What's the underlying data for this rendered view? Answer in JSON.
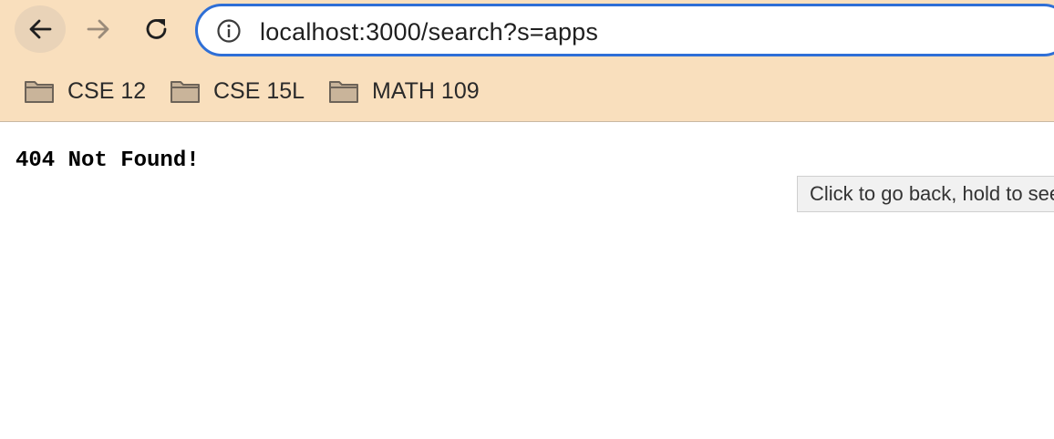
{
  "toolbar": {
    "back_button": "Back",
    "forward_button": "Forward",
    "reload_button": "Reload"
  },
  "omnibox": {
    "url": "localhost:3000/search?s=apps"
  },
  "bookmarks": [
    {
      "label": "CSE 12"
    },
    {
      "label": "CSE 15L"
    },
    {
      "label": "MATH 109"
    }
  ],
  "page": {
    "message": "404 Not Found!"
  },
  "tooltip": {
    "text": "Click to go back, hold to see history"
  },
  "colors": {
    "toolbar_bg": "#f9dfbd",
    "omnibox_border": "#2f6fd6",
    "folder_fill": "#c9b49a"
  }
}
